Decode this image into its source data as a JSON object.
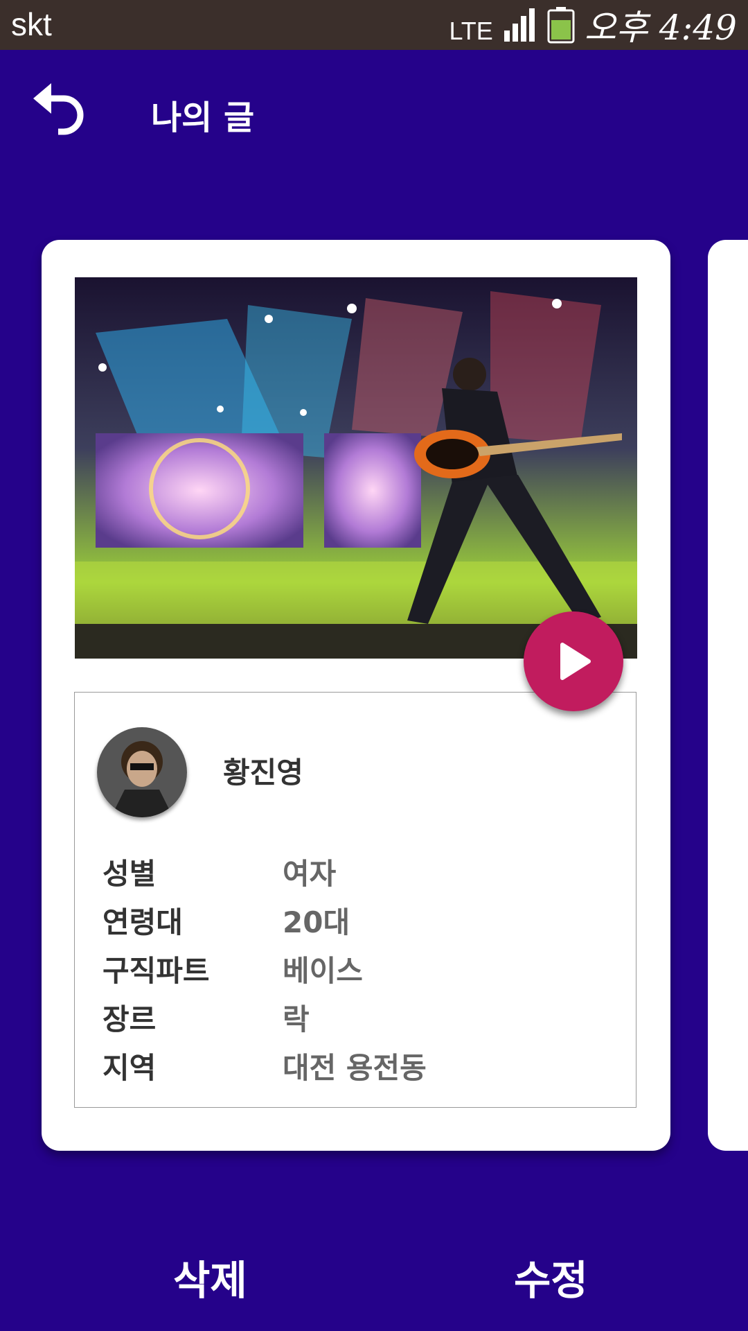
{
  "status": {
    "carrier": "skt",
    "network": "LTE",
    "time": "오후 4:49"
  },
  "header": {
    "title": "나의 글"
  },
  "post": {
    "name": "황진영",
    "fields": [
      {
        "label": "성별",
        "value": "여자"
      },
      {
        "label": "연령대",
        "value": "20대"
      },
      {
        "label": "구직파트",
        "value": "베이스"
      },
      {
        "label": "장르",
        "value": "락"
      },
      {
        "label": "지역",
        "value": "대전 용전동"
      }
    ]
  },
  "actions": {
    "delete": "삭제",
    "edit": "수정"
  },
  "colors": {
    "background": "#25028A",
    "play": "#C11C5E",
    "statusbar": "#3B2F2B"
  }
}
